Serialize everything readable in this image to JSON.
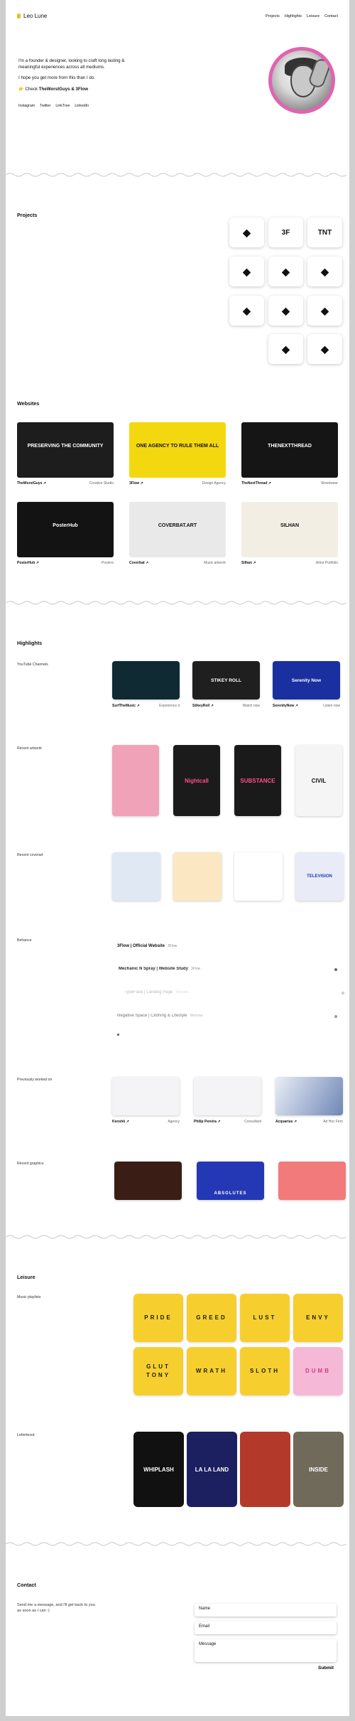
{
  "header": {
    "logo": "Leo Lune",
    "nav": [
      "Projects",
      "Highlights",
      "Leisure",
      "Contact"
    ]
  },
  "intro": {
    "line1": "I'm a founder & designer, looking to craft long lasting & meaningful experiences across all mediums.",
    "line2": "I hope you get more from this than I do.",
    "check_prefix": "Check",
    "check_link": "TheWorstGuys & 3Flow",
    "socials": [
      "Instagram",
      "Twitter",
      "LinkTree",
      "LinkedIn"
    ]
  },
  "projects": {
    "title": "Projects",
    "icons": [
      "bear-glasses-icon",
      "3f-logo-icon",
      "tnt-logo-icon",
      "square-ring-icon",
      "flame-heart-icon",
      "bear-head-icon",
      "cloud-rain-icon",
      "mask-heart-icon",
      "sparkle-icon",
      "scissors-circle-icon",
      "infinity-lines-icon"
    ],
    "icon_text": [
      "",
      "3F",
      "TNT",
      "",
      "",
      "",
      "",
      "",
      "",
      "",
      ""
    ]
  },
  "websites": {
    "title": "Websites",
    "items": [
      {
        "name": "TheWorstGuys",
        "type": "Creative Studio",
        "headline": "PRESERVING THE COMMUNITY",
        "bg": "#1d1d1d"
      },
      {
        "name": "3Flow",
        "type": "Design Agency",
        "headline": "ONE AGENCY TO RULE THEM ALL",
        "bg": "#f4d80f"
      },
      {
        "name": "TheNextThread",
        "type": "Streetwear",
        "headline": "THENEXTTHREAD",
        "bg": "#151515"
      },
      {
        "name": "PosterHub",
        "type": "Posters",
        "headline": "PosterHub",
        "bg": "#131313"
      },
      {
        "name": "Coverbat",
        "type": "Music artwork",
        "headline": "COVERBAT.ART",
        "bg": "#e9e9e9"
      },
      {
        "name": "Silhan",
        "type": "Artist Portfolio",
        "headline": "SILHAN",
        "bg": "#f3eee3"
      }
    ]
  },
  "highlights": {
    "title": "Highlights",
    "youtube_label": "YouTube Channels",
    "youtube": [
      {
        "name": "SurfTheMusic",
        "note": "Experience it",
        "title": "",
        "bg": "#0f2a33"
      },
      {
        "name": "StikeyRoll",
        "note": "Watch now",
        "title": "STIKEY ROLL",
        "bg": "#1f1f1f"
      },
      {
        "name": "SerenityNow",
        "note": "Listen now",
        "title": "Serenity Now",
        "bg": "#1a2fa0"
      }
    ],
    "artwork_label": "Recent artwork",
    "artwork": [
      {
        "title": "",
        "bg": "#f0a3b8"
      },
      {
        "title": "Nightcall",
        "bg": "#1b1b1b"
      },
      {
        "title": "SUBSTANCE",
        "bg": "#1a1a1a"
      },
      {
        "title": "CIVIL",
        "bg": "#f5f5f5"
      }
    ],
    "coverart_label": "Recent coverart",
    "coverart": [
      {
        "title": "",
        "bg": "#dfe8f3"
      },
      {
        "title": "",
        "bg": "#fbe7c2"
      },
      {
        "title": "",
        "bg": "#ffffff"
      },
      {
        "title": "TELEVISION",
        "bg": "#e9ecf6"
      }
    ],
    "behance_label": "Behance",
    "behance": [
      {
        "title": "3Flow | Official Website",
        "tag": "3Flow"
      },
      {
        "title": "Mechanic N Spray | Website Study",
        "tag": "3Flow"
      },
      {
        "title": "TypeFace | Landing Page",
        "tag": "Website"
      },
      {
        "title": "Negative Space | Clothing & Lifestyle",
        "tag": "Website"
      }
    ],
    "worked_label": "Previously worked on",
    "worked": [
      {
        "name": "Kenshō",
        "note": "Agency"
      },
      {
        "name": "Philip Pereira",
        "note": "Consultant"
      },
      {
        "name": "Acquarius",
        "note": "Ad Hoc Firm"
      }
    ],
    "graphics_label": "Recent graphics",
    "graphics": [
      {
        "title": "",
        "bg": "#3a1d14"
      },
      {
        "title": "ABSOLUTES",
        "bg": "#2438b6"
      },
      {
        "title": "",
        "bg": "#f37a7a"
      }
    ]
  },
  "leisure": {
    "title": "Leisure",
    "playlists_label": "Music playlists",
    "playlists": [
      "PRIDE",
      "GREED",
      "LUST",
      "ENVY",
      "GLUT TONY",
      "WRATH",
      "SLOTH",
      "DUMB"
    ],
    "letterboxd_label": "Letterboxd",
    "movies": [
      {
        "title": "WHIPLASH",
        "bg": "#111111"
      },
      {
        "title": "LA LA LAND",
        "bg": "#1c2060"
      },
      {
        "title": "",
        "bg": "#b33a2a"
      },
      {
        "title": "INSIDE",
        "bg": "#6f6a5a"
      }
    ]
  },
  "contact": {
    "title": "Contact",
    "text": "Send me a message, and I'll get back to you as soon as I can :)",
    "name_placeholder": "Name",
    "email_placeholder": "Email",
    "message_placeholder": "Message",
    "submit": "Submit"
  },
  "colors": {
    "accent": "#e064b0",
    "yellow": "#f6cf2f",
    "logo_dot": "#f2b705"
  }
}
